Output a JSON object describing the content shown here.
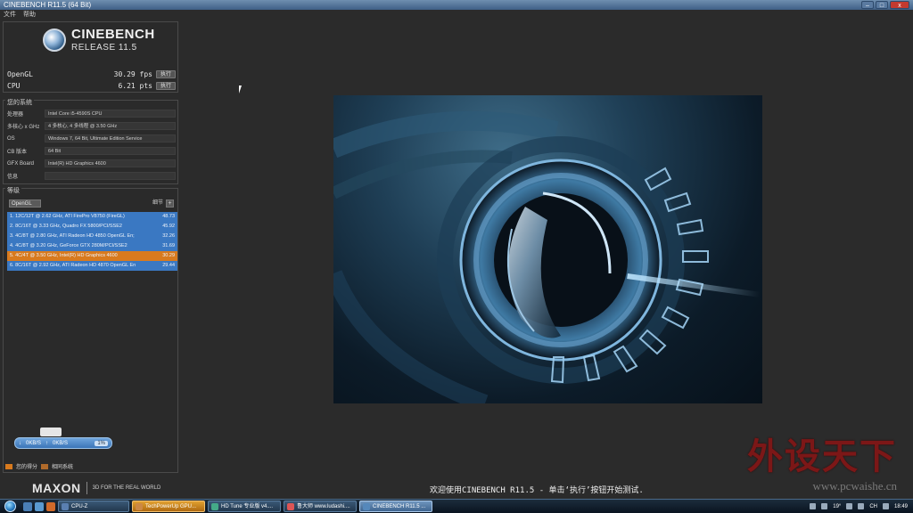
{
  "window": {
    "title": "CINEBENCH R11.5 (64 Bit)",
    "controls": [
      "–",
      "□",
      "x"
    ]
  },
  "menu": [
    "文件",
    "帮助"
  ],
  "logo": {
    "name": "CINEBENCH",
    "release": "RELEASE 11.5"
  },
  "scores": [
    {
      "label": "OpenGL",
      "value": "30.29 fps",
      "button": "执行"
    },
    {
      "label": "CPU",
      "value": "6.21 pts",
      "button": "执行"
    }
  ],
  "system": {
    "title": "您的系统",
    "rows": [
      {
        "key": "处理器",
        "value": "Intel Core i5-4590S CPU"
      },
      {
        "key": "多核心 x GHz",
        "value": "4 多核心, 4 多线程 @ 3.50 GHz"
      },
      {
        "key": "OS",
        "value": "Windows 7, 64 Bit, Ultimate Edition Service"
      },
      {
        "key": "CB 版本",
        "value": "64 Bit"
      },
      {
        "key": "GFX Board",
        "value": "Intel(R) HD Graphics 4600"
      },
      {
        "key": "信息",
        "value": ""
      }
    ]
  },
  "ranking": {
    "title": "等级",
    "dropdown": "OpenGL",
    "detail_label": "细节",
    "plus": "+",
    "items": [
      {
        "text": "1. 12C/12T @ 2.62 GHz, ATI FirePro V8750 (FireGL)",
        "score": "48.73",
        "color": "#3a78c2"
      },
      {
        "text": "2. 8C/16T @ 3.33 GHz, Quadro FX 5800/PCI/SSE2",
        "score": "45.92",
        "color": "#3a78c2"
      },
      {
        "text": "3. 4C/8T @ 2.80 GHz, ATI Radeon HD 4850 OpenGL En;",
        "score": "32.26",
        "color": "#3a78c2"
      },
      {
        "text": "4. 4C/8T @ 3.20 GHz, GeForce GTX 280M/PCI/SSE2",
        "score": "31.69",
        "color": "#3a78c2"
      },
      {
        "text": "5. 4C/4T @ 3.50 GHz, Intel(R) HD Graphics 4600",
        "score": "30.29",
        "color": "#d87a1e"
      },
      {
        "text": "6. 8C/16T @ 2.92 GHz, ATI Radeon HD 4870 OpenGL En",
        "score": "29.44",
        "color": "#3a78c2"
      }
    ]
  },
  "network": {
    "down": "0KB/S",
    "up": "0KB/S",
    "pct": "1%"
  },
  "legend": [
    "您的得分",
    "相同系统"
  ],
  "footer": {
    "brand": "MAXON",
    "tagline": "3D FOR THE REAL WORLD",
    "status": "欢迎使用CINEBENCH R11.5 - 单击‘执行’按钮开始测试."
  },
  "watermark": {
    "cn": "外设天下",
    "url": "www.pcwaishe.cn"
  },
  "taskbar": {
    "tasks": [
      {
        "label": "CPU-Z",
        "state": "normal",
        "icon": "#5a7fb0"
      },
      {
        "label": "TechPowerUp GPU...",
        "state": "active",
        "icon": "#c84"
      },
      {
        "label": "HD Tune 专业版 v4....",
        "state": "normal",
        "icon": "#4a8"
      },
      {
        "label": "鲁大师 www.ludashi....",
        "state": "normal",
        "icon": "#d55"
      },
      {
        "label": "CINEBENCH R11.5 ...",
        "state": "current",
        "icon": "#58b"
      }
    ],
    "tray": {
      "temp": "19°",
      "lang": "CH",
      "time": "18:49"
    }
  }
}
